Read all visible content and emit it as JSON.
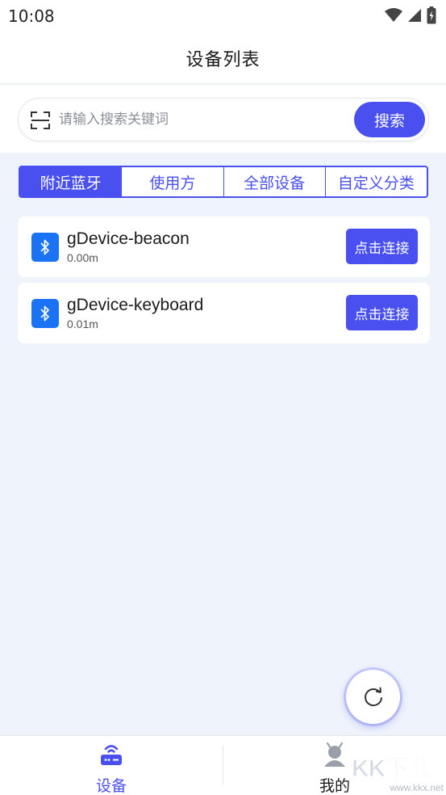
{
  "status_bar": {
    "time": "10:08"
  },
  "header": {
    "title": "设备列表"
  },
  "search": {
    "placeholder": "请输入搜索关键词",
    "value": "",
    "button_label": "搜索"
  },
  "tabs": [
    {
      "label": "附近蓝牙",
      "active": true
    },
    {
      "label": "使用方",
      "active": false
    },
    {
      "label": "全部设备",
      "active": false
    },
    {
      "label": "自定义分类",
      "active": false
    }
  ],
  "devices": [
    {
      "name": "gDevice-beacon",
      "distance": "0.00m",
      "connect_label": "点击连接",
      "icon": "bluetooth-icon"
    },
    {
      "name": "gDevice-keyboard",
      "distance": "0.01m",
      "connect_label": "点击连接",
      "icon": "bluetooth-icon"
    }
  ],
  "fab": {
    "icon": "refresh-icon"
  },
  "bottom_nav": [
    {
      "label": "设备",
      "icon": "router-device-icon",
      "active": true
    },
    {
      "label": "我的",
      "icon": "android-robot-icon",
      "active": false
    }
  ],
  "watermark": {
    "main": "KK下载",
    "sub": "www.kkx.net"
  },
  "colors": {
    "accent": "#4a50f0",
    "bluetooth": "#1a73f5",
    "background": "#eff3fb"
  }
}
